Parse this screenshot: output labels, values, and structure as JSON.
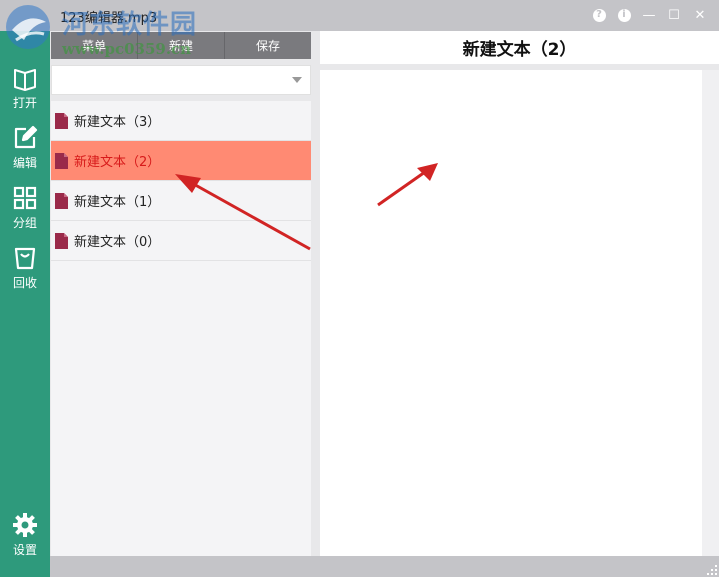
{
  "window": {
    "title": "123编辑器.mp3"
  },
  "watermark": {
    "text": "河东软件园",
    "url": "www.pc0359.cn"
  },
  "title_buttons": [
    {
      "name": "help-button",
      "glyph": "?"
    },
    {
      "name": "info-button",
      "glyph": "i"
    },
    {
      "name": "minimize-button",
      "glyph": "—"
    },
    {
      "name": "maximize-button",
      "glyph": "☐"
    },
    {
      "name": "close-button",
      "glyph": "✕"
    }
  ],
  "sidebar": {
    "items": [
      {
        "label": "打开",
        "icon": "book-open-icon"
      },
      {
        "label": "编辑",
        "icon": "edit-icon"
      },
      {
        "label": "分组",
        "icon": "grid-icon"
      },
      {
        "label": "回收",
        "icon": "bag-icon"
      },
      {
        "label": "设置",
        "icon": "gear-icon"
      }
    ]
  },
  "tabs": [
    {
      "label": "菜单"
    },
    {
      "label": "新建"
    },
    {
      "label": "保存"
    }
  ],
  "combo": {
    "value": ""
  },
  "notes": [
    {
      "label": "新建文本（3）",
      "selected": false
    },
    {
      "label": "新建文本（2）",
      "selected": true
    },
    {
      "label": "新建文本（1）",
      "selected": false
    },
    {
      "label": "新建文本（0）",
      "selected": false
    }
  ],
  "editor": {
    "title": "新建文本（2）",
    "content": ""
  },
  "colors": {
    "sidebar": "#2e9a7c",
    "selected_row": "#ff8a73",
    "selected_text": "#d71a1a",
    "doc_icon": "#9a2a4a",
    "arrow": "#d12424"
  }
}
